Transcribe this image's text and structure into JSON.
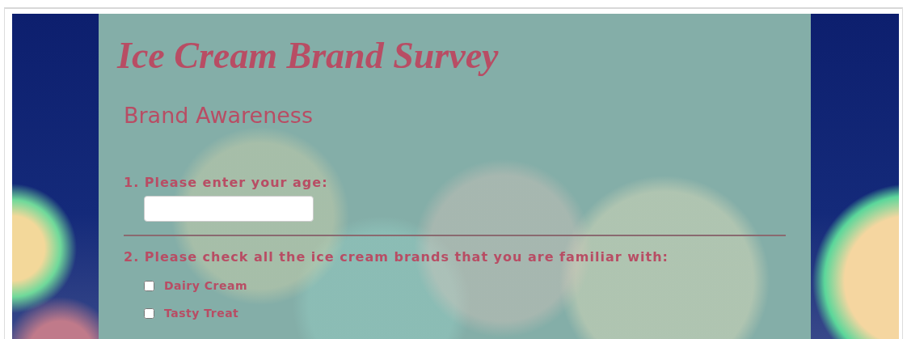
{
  "title": "Ice Cream Brand Survey",
  "section": {
    "heading": "Brand Awareness"
  },
  "questions": [
    {
      "kind": "text",
      "label": "1. Please enter your age:"
    },
    {
      "kind": "checkboxes",
      "label": "2. Please check all the ice cream brands that you are familiar with:",
      "options": [
        {
          "label": "Dairy Cream",
          "checked": false
        },
        {
          "label": "Tasty Treat",
          "checked": false
        }
      ]
    }
  ]
}
